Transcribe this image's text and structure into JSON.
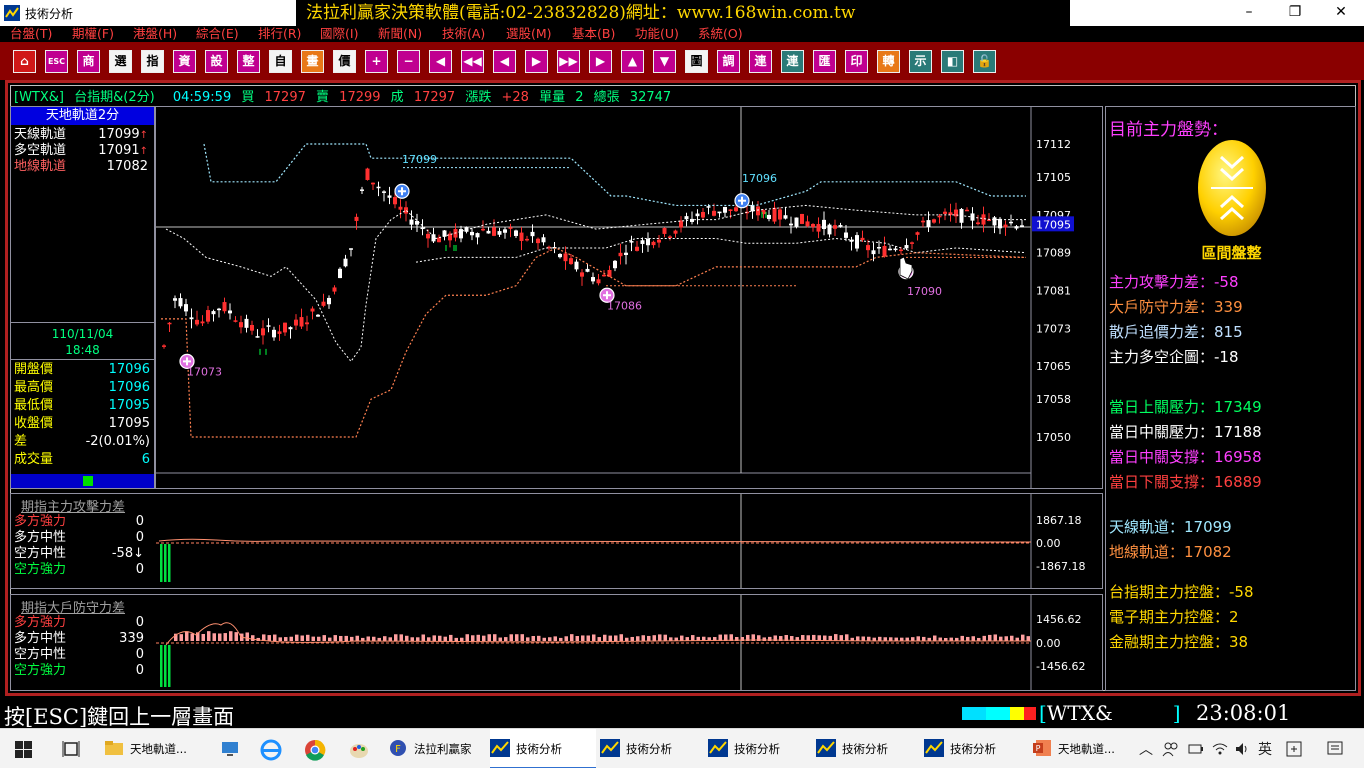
{
  "window": {
    "title": "技術分析",
    "banner": "法拉利贏家決策軟體(電話:02-23832828)網址：www.168win.com.tw",
    "controls": [
      "–",
      "❐",
      "✕"
    ]
  },
  "menu": [
    "台盤(T)",
    "期權(F)",
    "港盤(H)",
    "綜合(E)",
    "排行(R)",
    "國際(I)",
    "新聞(N)",
    "技術(A)",
    "選股(M)",
    "基本(B)",
    "功能(U)",
    "系統(O)"
  ],
  "toolbar": [
    {
      "label": "⌂",
      "style": "red"
    },
    {
      "label": "ESC",
      "style": "mag"
    },
    {
      "label": "商",
      "style": "mag"
    },
    {
      "label": "選",
      "style": "white"
    },
    {
      "label": "指",
      "style": "white"
    },
    {
      "label": "資",
      "style": "mag"
    },
    {
      "label": "設",
      "style": "mag"
    },
    {
      "label": "整",
      "style": "mag"
    },
    {
      "label": "自",
      "style": "white"
    },
    {
      "label": "畫",
      "style": "or"
    },
    {
      "label": "價",
      "style": "white"
    },
    {
      "label": "+",
      "style": "mag"
    },
    {
      "label": "−",
      "style": "mag"
    },
    {
      "label": "◀",
      "style": "mag"
    },
    {
      "label": "◀◀",
      "style": "mag"
    },
    {
      "label": "◀",
      "style": "mag"
    },
    {
      "label": "▶",
      "style": "mag"
    },
    {
      "label": "▶▶",
      "style": "mag"
    },
    {
      "label": "▶",
      "style": "mag"
    },
    {
      "label": "▲",
      "style": "mag"
    },
    {
      "label": "▼",
      "style": "mag"
    },
    {
      "label": "圖",
      "style": "white"
    },
    {
      "label": "調",
      "style": "mag"
    },
    {
      "label": "連",
      "style": "mag"
    },
    {
      "label": "連",
      "style": "teal"
    },
    {
      "label": "匯",
      "style": "mag"
    },
    {
      "label": "印",
      "style": "mag"
    },
    {
      "label": "轉",
      "style": "or"
    },
    {
      "label": "示",
      "style": "teal"
    },
    {
      "label": "◧",
      "style": "teal"
    },
    {
      "label": "🔓",
      "style": "teal"
    }
  ],
  "quote": {
    "symbol": "[WTX&]",
    "name": "台指期&(2分)",
    "time": "04:59:59",
    "buy_label": "買",
    "buy": "17297",
    "sell_label": "賣",
    "sell": "17299",
    "deal_label": "成",
    "deal": "17297",
    "change_label": "漲跌",
    "change": "+28",
    "vol_label": "單量",
    "vol": "2",
    "total_label": "總張",
    "total": "32747"
  },
  "indicator": {
    "title": "天地軌道2分",
    "rows": [
      {
        "label": "天線軌道",
        "value": "17099",
        "arrow": "↑",
        "color": "#ffffff"
      },
      {
        "label": "多空軌道",
        "value": "17091",
        "arrow": "↑",
        "color": "#ffffff"
      },
      {
        "label": "地線軌道",
        "value": "17082",
        "arrow": "",
        "color": "#ff6060"
      }
    ],
    "date": "110/11/04",
    "time": "18:48"
  },
  "prices": [
    {
      "label": "開盤價",
      "value": "17096",
      "color": "#00ffff"
    },
    {
      "label": "最高價",
      "value": "17096",
      "color": "#00ffff"
    },
    {
      "label": "最低價",
      "value": "17095",
      "color": "#00ffff"
    },
    {
      "label": "收盤價",
      "value": "17095",
      "color": "#ffffff"
    },
    {
      "label": "差",
      "value": "-2(0.01%)",
      "color": "#ffffff"
    },
    {
      "label": "成交量",
      "value": "6",
      "color": "#00ffff"
    }
  ],
  "chart_data": {
    "type": "line",
    "yticks": [
      "17112",
      "17105",
      "17097",
      "17089",
      "17081",
      "17073",
      "17065",
      "17058",
      "17050"
    ],
    "current_price": "17095",
    "markers": [
      {
        "label": "17099",
        "kind": "top"
      },
      {
        "label": "17096",
        "kind": "top"
      },
      {
        "label": "17086",
        "kind": "bottom"
      },
      {
        "label": "17090",
        "kind": "bottom"
      },
      {
        "label": "17073",
        "kind": "bottom"
      }
    ]
  },
  "sub1": {
    "title": "期指主力攻擊力差",
    "rows": [
      {
        "label": "多方強力",
        "value": "0",
        "color": "#ff4040"
      },
      {
        "label": "多方中性",
        "value": "0",
        "color": "#ffffff"
      },
      {
        "label": "空方中性",
        "value": "-58↓",
        "color": "#ffffff"
      },
      {
        "label": "空方強力",
        "value": "0",
        "color": "#00ff40"
      }
    ],
    "yticks": [
      "1867.18",
      "0.00",
      "-1867.18"
    ]
  },
  "sub2": {
    "title": "期指大戶防守力差",
    "rows": [
      {
        "label": "多方強力",
        "value": "0",
        "color": "#ff4040"
      },
      {
        "label": "多方中性",
        "value": "339",
        "color": "#ffffff"
      },
      {
        "label": "空方中性",
        "value": "0",
        "color": "#ffffff"
      },
      {
        "label": "空方強力",
        "value": "0",
        "color": "#00ff40"
      }
    ],
    "yticks": [
      "1456.62",
      "0.00",
      "-1456.62"
    ]
  },
  "right_panel": {
    "title": "目前主力盤勢：",
    "state": "區間盤整",
    "rows": [
      {
        "text": "主力攻擊力差：-58",
        "color": "#ff40ff"
      },
      {
        "text": "大戶防守力差：339",
        "color": "#ff9040"
      },
      {
        "text": "散戶追價力差：815",
        "color": "#c0e0ff"
      },
      {
        "text": "主力多空企圖：-18",
        "color": "#ffffff"
      },
      {
        "text": "當日上關壓力：17349",
        "color": "#00ff60"
      },
      {
        "text": "當日中關壓力：17188",
        "color": "#ffffff"
      },
      {
        "text": "當日中關支撐：16958",
        "color": "#ff40ff"
      },
      {
        "text": "當日下關支撐：16889",
        "color": "#ff4040"
      },
      {
        "text": "天線軌道：17099",
        "color": "#a0e8ff"
      },
      {
        "text": "地線軌道：17082",
        "color": "#ff9040"
      },
      {
        "text": "台指期主力控盤：-58",
        "color": "#ffd700"
      },
      {
        "text": "電子期主力控盤：2",
        "color": "#ffd700"
      },
      {
        "text": "金融期主力控盤：38",
        "color": "#ffd700"
      }
    ]
  },
  "status": {
    "message": "按[ESC]鍵回上一層畫面",
    "code": "WTX&",
    "clock": "23:08:01"
  },
  "taskbar": {
    "items": [
      "天地軌道...",
      "法拉利贏家",
      "技術分析",
      "技術分析",
      "技術分析",
      "技術分析",
      "技術分析",
      "天地軌道..."
    ],
    "ime": "英"
  }
}
